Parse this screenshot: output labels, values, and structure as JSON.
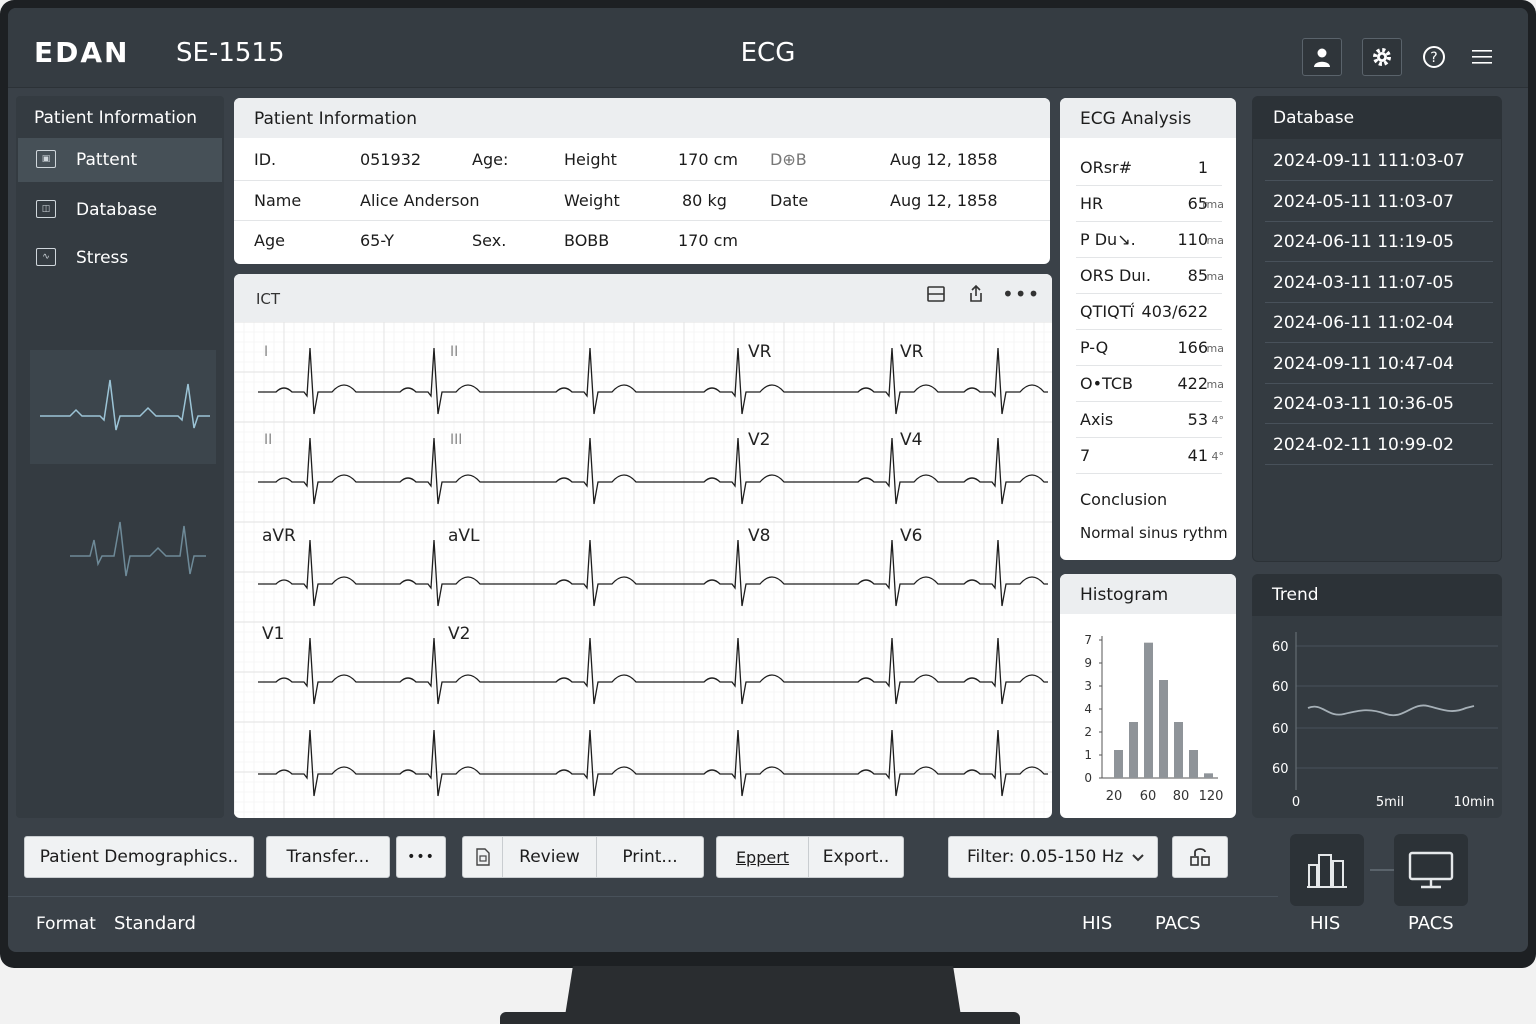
{
  "header": {
    "brand": "EDAN",
    "model": "SE-1515",
    "title": "ECG",
    "user_icon": "user-icon",
    "settings_icon": "gear-icon",
    "help_icon": "help-icon",
    "menu_icon": "hamburger-menu-icon"
  },
  "sidebar": {
    "title": "Patient Information",
    "items": [
      {
        "label": "Pattent",
        "icon": "patient-icon"
      },
      {
        "label": "Database",
        "icon": "database-icon"
      },
      {
        "label": "Stress",
        "icon": "stress-icon"
      }
    ]
  },
  "patient_info": {
    "title": "Patient Information",
    "rows": [
      [
        "ID.",
        "051932",
        "Age:",
        "Height",
        "170 cm",
        "D⊕B",
        "Aug 12, 1858"
      ],
      [
        "Name",
        "Alice Anderson",
        "",
        "Weight",
        "80  kg",
        "Date",
        "Aug 12, 1858"
      ],
      [
        "Age",
        "65-Y",
        "Sex.",
        "BOBB",
        "170 cm",
        "",
        ""
      ]
    ]
  },
  "ecg": {
    "toolbar_label": "ICT",
    "lead_labels": {
      "r1": [
        "I",
        "II",
        "VR",
        "VR"
      ],
      "r2": [
        "II",
        "III",
        "V2",
        "V4"
      ],
      "r3": [
        "aVR",
        "aVL",
        "V8",
        "V6"
      ],
      "r4": [
        "V1",
        "V2",
        "",
        ""
      ]
    }
  },
  "ecg_analysis": {
    "title": "ECG Analysis",
    "rows": [
      {
        "k": "ORsr#",
        "v": "1",
        "u": ""
      },
      {
        "k": "HR",
        "v": "65",
        "u": "rma"
      },
      {
        "k": "P Du↘.",
        "v": "110",
        "u": "ma"
      },
      {
        "k": "ORS Duı.",
        "v": "85",
        "u": "ma"
      },
      {
        "k": "QTIQTḯ",
        "v": "403/622",
        "u": ""
      },
      {
        "k": "P-Q",
        "v": "166",
        "u": "ma"
      },
      {
        "k": "O•TCB",
        "v": "422",
        "u": "ma"
      },
      {
        "k": "Axis",
        "v": "53",
        "u": "4°"
      },
      {
        "k": "7",
        "v": "41",
        "u": "4°"
      }
    ],
    "conclusion_label": "Conclusion",
    "conclusion_text": "Normal sinus rythm"
  },
  "database": {
    "title": "Database",
    "items": [
      "2024-09-11 111:03-07",
      "2024-05-11 11:03-07",
      "2024-06-11 11:19-05",
      "2024-03-11 11:07-05",
      "2024-06-11 11:02-04",
      "2024-09-11 10:47-04",
      "2024-03-11 10:36-05",
      "2024-02-11 10:99-02"
    ]
  },
  "histogram": {
    "title": "Histogram",
    "y_ticks": [
      "7",
      "9",
      "3",
      "4",
      "2",
      "1",
      "0"
    ],
    "x_ticks": [
      "20",
      "60",
      "80",
      "120"
    ],
    "bars": [
      0.12,
      0.24,
      0.58,
      0.42,
      0.24,
      0.12,
      0.02
    ]
  },
  "trend": {
    "title": "Trend",
    "y_ticks": [
      "60",
      "60",
      "60",
      "60"
    ],
    "x_ticks": [
      "0",
      "5mil",
      "10min"
    ]
  },
  "toolbar": {
    "patient_demographics": "Patient Demographics..",
    "transfer": "Transfer...",
    "more": "•••",
    "review": "Review",
    "print": "Print...",
    "eppert": "Eppert",
    "export": "Export..",
    "filter": "Filter:  0.05-150 Hz",
    "lock_icon": "lock-icon"
  },
  "footer": {
    "format_label": "Format",
    "format_value": "Standard",
    "his": "HIS",
    "pacs": "PACS",
    "his_big": "HIS",
    "pacs_big": "PACS"
  }
}
